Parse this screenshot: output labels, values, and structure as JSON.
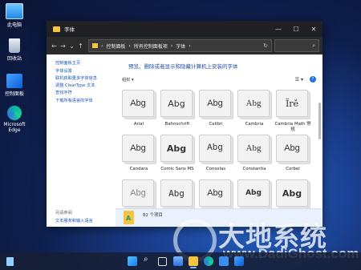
{
  "desktop": {
    "icons": [
      {
        "label": "此电脑"
      },
      {
        "label": "回收站"
      },
      {
        "label": "控制面板"
      },
      {
        "label": "Microsoft Edge"
      }
    ]
  },
  "window": {
    "title": "字体",
    "controls": {
      "minimize": "—",
      "maximize": "☐",
      "close": "✕"
    },
    "address": {
      "crumbs": [
        "控制面板",
        "所有控制面板项",
        "字体"
      ],
      "separator": "›"
    }
  },
  "sidebar": {
    "home": "控制面板主页",
    "links": [
      "字体设置",
      "联机获取更多字体信息",
      "调整 ClearType 文本",
      "查找字符",
      "下载所有语言的字体"
    ],
    "see_also": "另请参阅",
    "see_link": "文本服务和输入语言"
  },
  "content": {
    "headline": "预览、删除或者显示和隐藏计算机上安装的字体",
    "organize": "组织 ▾",
    "fonts": [
      {
        "sample": "Abg",
        "name": "Arial"
      },
      {
        "sample": "Abg",
        "name": "Bahnschrift"
      },
      {
        "sample": "Abg",
        "name": "Calibri"
      },
      {
        "sample": "Abg",
        "name": "Cambria"
      },
      {
        "sample": "Ïrě",
        "name": "Cambria Math 常规"
      },
      {
        "sample": "Abg",
        "name": "Candara"
      },
      {
        "sample": "Abg",
        "name": "Comic Sans MS"
      },
      {
        "sample": "Abg",
        "name": "Consolas"
      },
      {
        "sample": "Abg",
        "name": "Constantia"
      },
      {
        "sample": "Abg",
        "name": "Corbel"
      },
      {
        "sample": "Abg",
        "name": ""
      },
      {
        "sample": "Abg",
        "name": ""
      },
      {
        "sample": "Abg",
        "name": ""
      },
      {
        "sample": "Abg",
        "name": ""
      },
      {
        "sample": "Abg",
        "name": ""
      }
    ],
    "status": "82 个项目"
  },
  "watermark": {
    "text": "大地系统",
    "url": "www.DadiGhost.com"
  }
}
